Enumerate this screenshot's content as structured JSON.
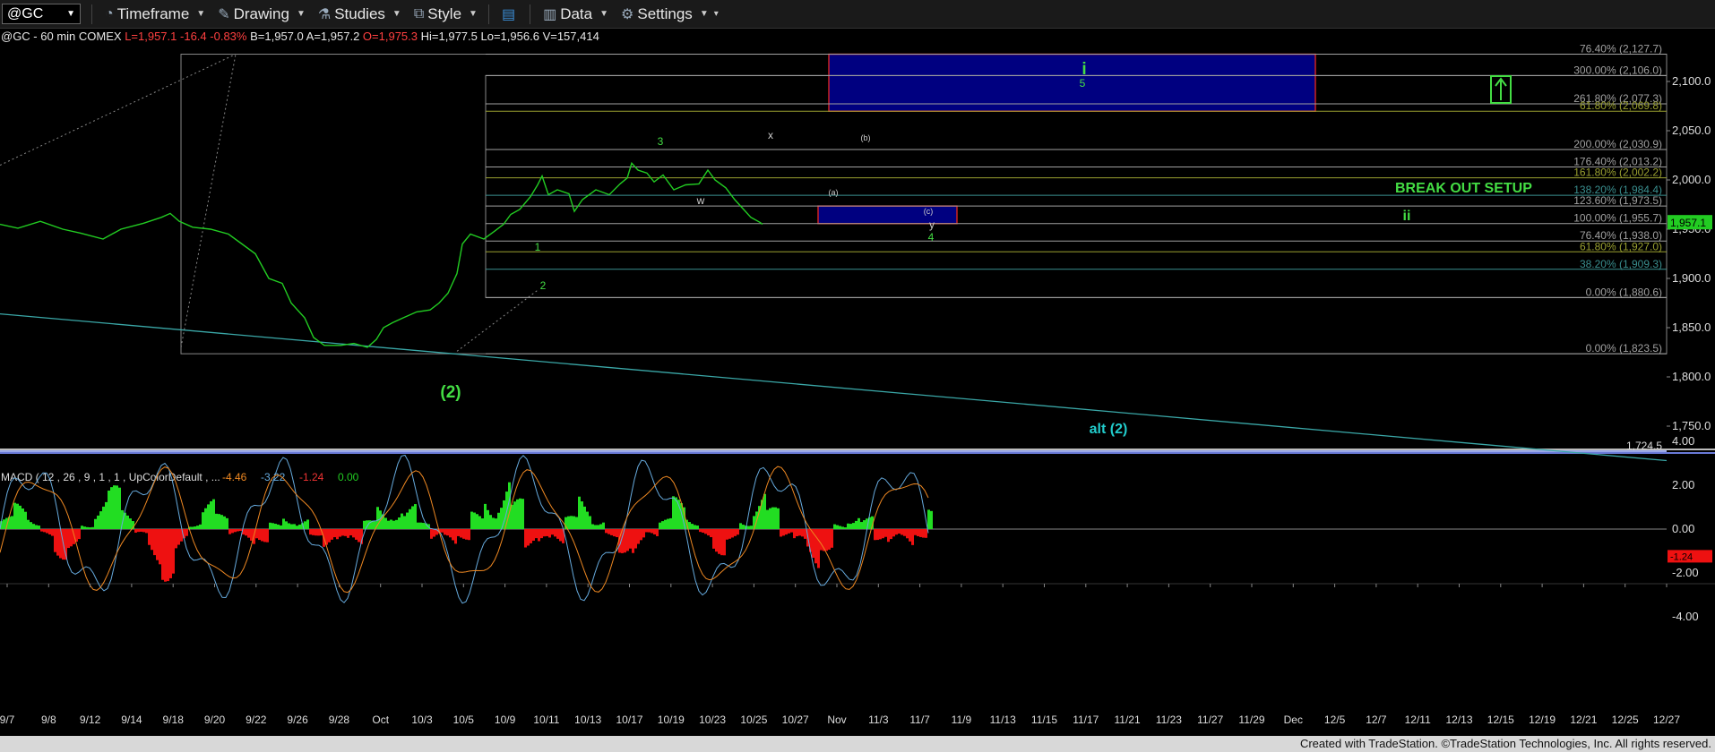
{
  "toolbar": {
    "symbol": "@GC",
    "timeframe": "Timeframe",
    "drawing": "Drawing",
    "studies": "Studies",
    "style": "Style",
    "data": "Data",
    "settings": "Settings"
  },
  "info": {
    "symbol_desc": "@GC - 60 min COMEX",
    "last": "L=1,957.1",
    "change": "-16.4",
    "change_pct": "-0.83%",
    "bid": "B=1,957.0",
    "ask": "A=1,957.2",
    "open": "O=1,975.3",
    "high": "Hi=1,977.5",
    "low": "Lo=1,956.6",
    "volume": "V=157,414"
  },
  "colors": {
    "price": "#22cc22",
    "fib_line": "#a0a0a0",
    "target_box": "#000080",
    "target_border": "#cc2222",
    "trendline": "#3aa7a7",
    "label_green": "#44dd44",
    "label_cyan": "#22cccc",
    "macd_pos": "#22dd22",
    "macd_neg": "#ee1111",
    "macd_line": "#66aadd",
    "signal_line": "#ee8822"
  },
  "chart_data": [
    {
      "type": "line",
      "title": "@GC - 60 min COMEX",
      "x_dates": [
        "9/7",
        "9/8",
        "9/12",
        "9/14",
        "9/18",
        "9/20",
        "9/22",
        "9/26",
        "9/28",
        "Oct",
        "10/3",
        "10/5",
        "10/9",
        "10/11",
        "10/13",
        "10/17",
        "10/19",
        "10/23",
        "10/25",
        "10/27",
        "Nov",
        "11/3",
        "11/7",
        "11/9",
        "11/13",
        "11/15",
        "11/17",
        "11/21",
        "11/23",
        "11/27",
        "11/29",
        "Dec",
        "12/5",
        "12/7",
        "12/11",
        "12/13",
        "12/15",
        "12/19",
        "12/21",
        "12/25",
        "12/27"
      ],
      "y_ticks": [
        "1,750.0",
        "1,800.0",
        "1,850.0",
        "1,900.0",
        "1,950.0",
        "2,000.0",
        "2,050.0",
        "2,100.0"
      ],
      "ylim": [
        1710,
        2138
      ],
      "last_price": "1,957.1",
      "series": [
        {
          "values": [
            [
              0,
              1955
            ],
            [
              20,
              1951
            ],
            [
              45,
              1958
            ],
            [
              70,
              1950
            ],
            [
              90,
              1946
            ],
            [
              115,
              1940
            ],
            [
              135,
              1950
            ],
            [
              160,
              1956
            ],
            [
              180,
              1962
            ],
            [
              190,
              1966
            ],
            [
              200,
              1958
            ],
            [
              215,
              1952
            ],
            [
              235,
              1950
            ],
            [
              255,
              1945
            ],
            [
              270,
              1935
            ],
            [
              285,
              1925
            ],
            [
              300,
              1900
            ],
            [
              315,
              1895
            ],
            [
              325,
              1875
            ],
            [
              340,
              1860
            ],
            [
              350,
              1840
            ],
            [
              362,
              1832
            ],
            [
              380,
              1832
            ],
            [
              395,
              1834
            ],
            [
              410,
              1830
            ],
            [
              420,
              1838
            ],
            [
              428,
              1850
            ],
            [
              438,
              1855
            ],
            [
              450,
              1860
            ],
            [
              465,
              1866
            ],
            [
              480,
              1868
            ],
            [
              490,
              1875
            ],
            [
              500,
              1885
            ],
            [
              510,
              1905
            ],
            [
              516,
              1935
            ],
            [
              525,
              1945
            ],
            [
              540,
              1940
            ],
            [
              552,
              1948
            ],
            [
              562,
              1955
            ],
            [
              570,
              1965
            ],
            [
              580,
              1970
            ],
            [
              592,
              1983
            ],
            [
              600,
              1995
            ],
            [
              605,
              2004
            ],
            [
              612,
              1985
            ],
            [
              622,
              1990
            ],
            [
              635,
              1986
            ],
            [
              641,
              1968
            ],
            [
              650,
              1980
            ],
            [
              665,
              1990
            ],
            [
              680,
              1985
            ],
            [
              692,
              1996
            ],
            [
              700,
              2002
            ],
            [
              705,
              2017
            ],
            [
              712,
              2010
            ],
            [
              722,
              2007
            ],
            [
              730,
              1998
            ],
            [
              740,
              2005
            ],
            [
              752,
              1990
            ],
            [
              765,
              1995
            ],
            [
              780,
              1996
            ],
            [
              790,
              2010
            ],
            [
              798,
              2000
            ],
            [
              810,
              1992
            ],
            [
              820,
              1980
            ],
            [
              830,
              1970
            ],
            [
              838,
              1962
            ],
            [
              848,
              1957
            ],
            [
              851,
              1955
            ]
          ]
        }
      ],
      "fib_labels": [
        {
          "text": "76.40% (2,127.7)",
          "value": 2127.7
        },
        {
          "text": "300.00% (2,106.0)",
          "value": 2106.0
        },
        {
          "text": "261.80% (2,077.3)",
          "value": 2077.3
        },
        {
          "text": "61.80% (2,069.8)",
          "value": 2069.8
        },
        {
          "text": "200.00% (2,030.9)",
          "value": 2030.9
        },
        {
          "text": "176.40% (2,013.2)",
          "value": 2013.2
        },
        {
          "text": "161.80% (2,002.2)",
          "value": 2002.2
        },
        {
          "text": "138.20% (1,984.4)",
          "value": 1984.4
        },
        {
          "text": "123.60% (1,973.5)",
          "value": 1973.5
        },
        {
          "text": "100.00% (1,955.7)",
          "value": 1955.7
        },
        {
          "text": "76.40% (1,938.0)",
          "value": 1938.0
        },
        {
          "text": "61.80% (1,927.0)",
          "value": 1927.0
        },
        {
          "text": "38.20% (1,909.3)",
          "value": 1909.3
        },
        {
          "text": "0.00% (1,880.6)",
          "value": 1880.6
        },
        {
          "text": "0.00% (1,823.5)",
          "value": 1823.5
        },
        {
          "text": "1,724.5",
          "value": 1724.5
        }
      ],
      "wave_labels": [
        "(2)",
        "1",
        "2",
        "3",
        "4",
        "5",
        "i",
        "ii",
        "w",
        "x",
        "y",
        "(a)",
        "(b)",
        "(c)",
        "alt (2)"
      ],
      "annotations": [
        "BREAK OUT SETUP"
      ]
    },
    {
      "type": "bar",
      "title": "MACD ( 12 , 26 , 9 , 1 , 1 , UpColorDefault , ...",
      "values_text": [
        "-4.46",
        "-3.22",
        "-1.24",
        "0.00"
      ],
      "y_ticks": [
        "4.00",
        "2.00",
        "0.00",
        "-2.00",
        "-4.00"
      ],
      "ylim": [
        -5,
        5
      ],
      "current_value": "-1.24"
    }
  ],
  "footer": "Created with TradeStation. ©TradeStation Technologies, Inc. All rights reserved."
}
